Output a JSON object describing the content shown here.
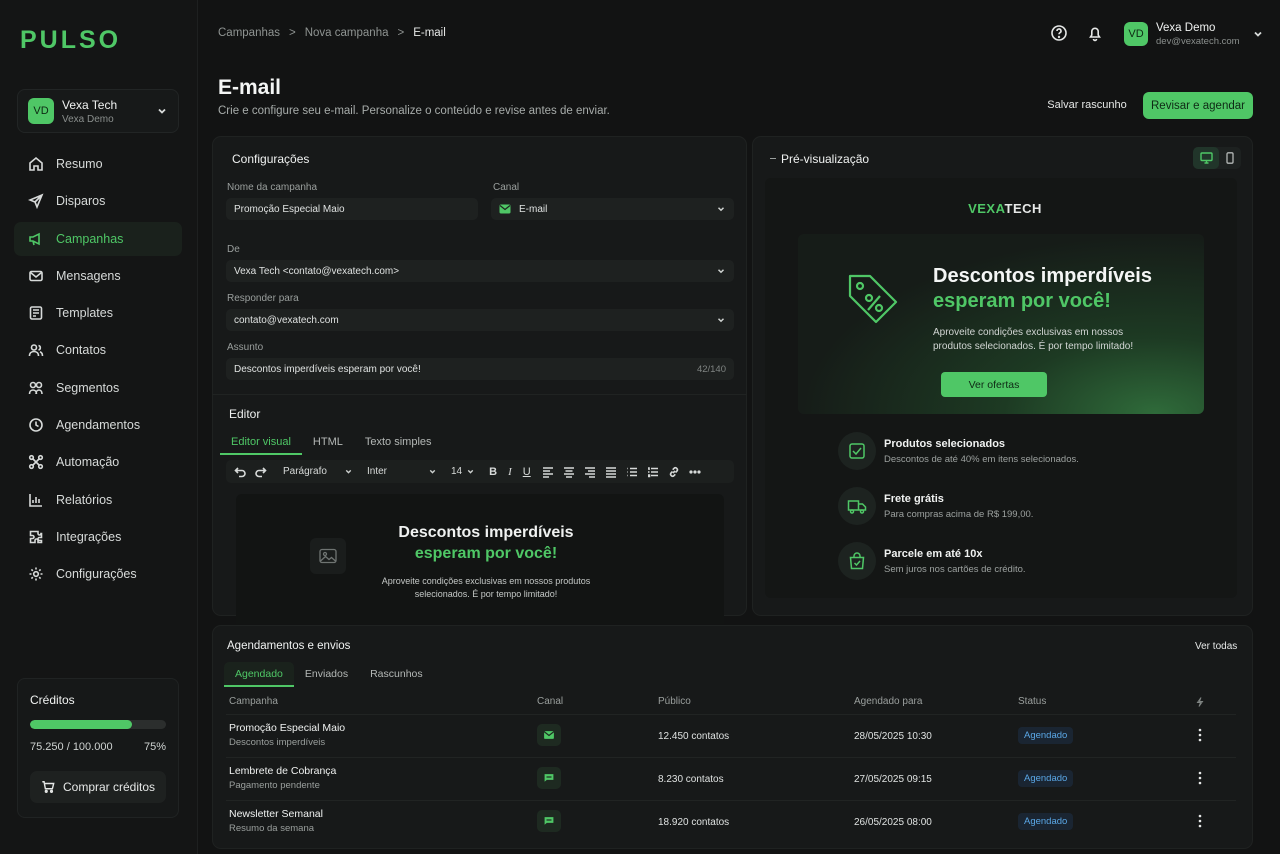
{
  "brand": "PULSO",
  "workspace": {
    "avatar": "VD",
    "name": "Vexa Tech",
    "sub": "Vexa Demo"
  },
  "nav": [
    {
      "label": "Resumo",
      "icon": "home-icon"
    },
    {
      "label": "Disparos",
      "icon": "send-icon"
    },
    {
      "label": "Campanhas",
      "icon": "megaphone-icon"
    },
    {
      "label": "Mensagens",
      "icon": "mail-icon"
    },
    {
      "label": "Templates",
      "icon": "template-icon"
    },
    {
      "label": "Contatos",
      "icon": "users-icon"
    },
    {
      "label": "Segmentos",
      "icon": "segments-icon"
    },
    {
      "label": "Agendamentos",
      "icon": "clock-icon"
    },
    {
      "label": "Automação",
      "icon": "automation-icon"
    },
    {
      "label": "Relatórios",
      "icon": "chart-icon"
    },
    {
      "label": "Integrações",
      "icon": "puzzle-icon"
    },
    {
      "label": "Configurações",
      "icon": "gear-icon"
    }
  ],
  "credits": {
    "title": "Créditos",
    "used": "75.250 / 100.000",
    "percent_label": "75%",
    "fraction": 0.75,
    "buy_label": "Comprar créditos"
  },
  "breadcrumb": [
    "Campanhas",
    "Nova campanha",
    "E-mail"
  ],
  "user": {
    "avatar": "VD",
    "name": "Vexa Demo",
    "email": "dev@vexatech.com"
  },
  "page": {
    "title": "E-mail",
    "subtitle": "Crie e configure seu e-mail. Personalize o conteúdo e revise antes de enviar.",
    "save_draft": "Salvar rascunho",
    "review": "Revisar e agendar"
  },
  "config": {
    "title": "Configurações",
    "name_label": "Nome da campanha",
    "name_value": "Promoção Especial Maio",
    "channel_label": "Canal",
    "channel_value": "E-mail",
    "from_label": "De",
    "from_value": "Vexa Tech <contato@vexatech.com>",
    "reply_label": "Responder para",
    "reply_value": "contato@vexatech.com",
    "subject_label": "Assunto",
    "subject_value": "Descontos imperdíveis esperam por você!",
    "subject_counter": "42/140"
  },
  "editor": {
    "title": "Editor",
    "tabs": [
      "Editor visual",
      "HTML",
      "Texto simples"
    ],
    "paragraph": "Parágrafo",
    "font": "Inter",
    "size": "14",
    "canvas_title_1": "Descontos imperdíveis",
    "canvas_title_2": "esperam por você!",
    "canvas_text": "Aproveite condições exclusivas em nossos produtos selecionados. É por tempo limitado!"
  },
  "preview": {
    "title": "Pré-visualização",
    "brand_a": "VEXA",
    "brand_b": "TECH",
    "hero_title_1": "Descontos imperdíveis",
    "hero_title_2": "esperam por você!",
    "hero_text": "Aproveite condições exclusivas em nossos produtos selecionados. É por tempo limitado!",
    "cta": "Ver ofertas",
    "features": [
      {
        "title": "Produtos selecionados",
        "sub": "Descontos de até 40% em itens selecionados.",
        "icon": "checklist-icon"
      },
      {
        "title": "Frete grátis",
        "sub": "Para compras acima de R$ 199,00.",
        "icon": "truck-icon"
      },
      {
        "title": "Parcele em até 10x",
        "sub": "Sem juros nos cartões de crédito.",
        "icon": "bag-icon"
      }
    ]
  },
  "schedule": {
    "title": "Agendamentos e envios",
    "see_all": "Ver todas",
    "tabs": [
      "Agendado",
      "Enviados",
      "Rascunhos"
    ],
    "columns": [
      "Campanha",
      "Canal",
      "Público",
      "Agendado para",
      "Status"
    ],
    "rows": [
      {
        "name": "Promoção Especial Maio",
        "sub": "Descontos imperdíveis",
        "channel": "mail-icon",
        "audience": "12.450 contatos",
        "date": "28/05/2025 10:30",
        "status": "Agendado"
      },
      {
        "name": "Lembrete de Cobrança",
        "sub": "Pagamento pendente",
        "channel": "chat-icon",
        "audience": "8.230 contatos",
        "date": "27/05/2025 09:15",
        "status": "Agendado"
      },
      {
        "name": "Newsletter Semanal",
        "sub": "Resumo da semana",
        "channel": "chat-icon",
        "audience": "18.920 contatos",
        "date": "26/05/2025 08:00",
        "status": "Agendado"
      }
    ]
  },
  "colors": {
    "accent": "#4fc766",
    "background": "#121313",
    "card": "#171919",
    "badge": "#5aa7e6"
  }
}
